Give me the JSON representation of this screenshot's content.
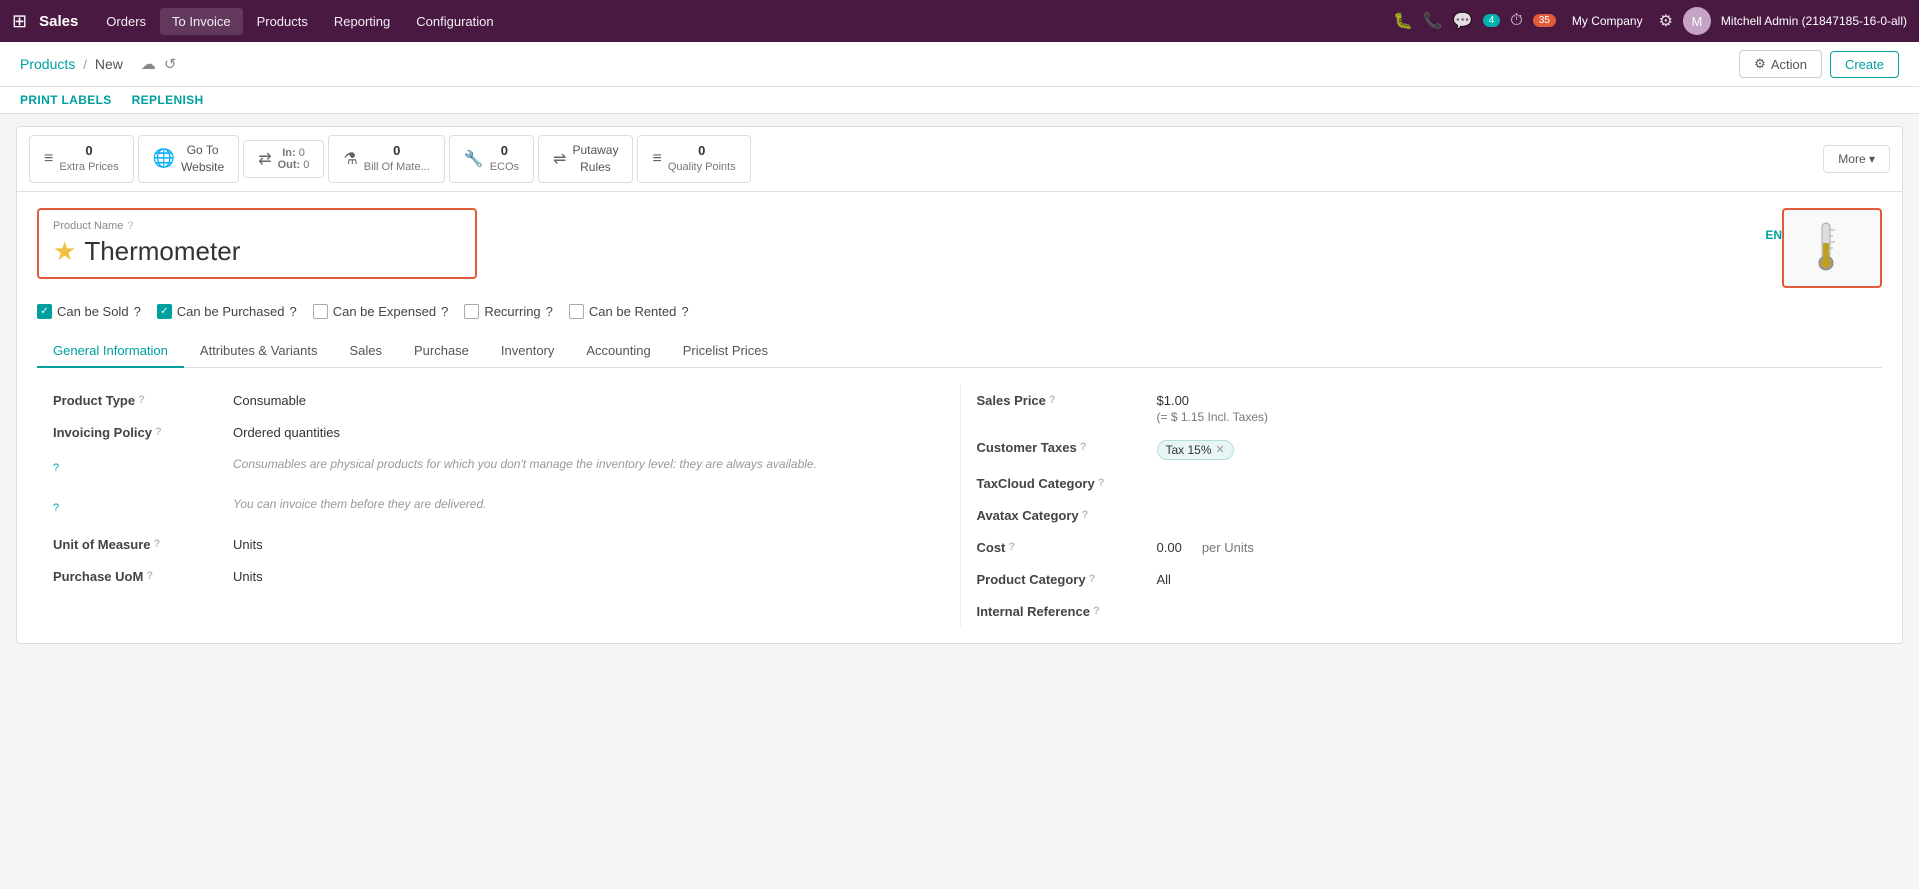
{
  "topbar": {
    "apps_icon": "⊞",
    "brand": "Sales",
    "nav_items": [
      "Orders",
      "To Invoice",
      "Products",
      "Reporting",
      "Configuration"
    ],
    "active_nav": "To Invoice",
    "bug_icon": "🐛",
    "phone_icon": "📞",
    "chat_icon": "💬",
    "chat_count": "4",
    "clock_icon": "⏱",
    "clock_count": "35",
    "company": "My Company",
    "settings_icon": "⚙",
    "user_initial": "M",
    "user_name": "Mitchell Admin (21847185-16-0-all)"
  },
  "breadcrumb": {
    "parent": "Products",
    "separator": "/",
    "current": "New",
    "cloud_icon": "☁",
    "refresh_icon": "↺"
  },
  "toolbar": {
    "action_label": "Action",
    "create_label": "Create",
    "gear_icon": "⚙"
  },
  "action_links": [
    {
      "label": "PRINT LABELS"
    },
    {
      "label": "REPLENISH"
    }
  ],
  "smart_buttons": [
    {
      "id": "extra-prices",
      "icon": "≡",
      "count": "0",
      "label": "Extra Prices"
    },
    {
      "id": "go-to-website",
      "icon": "🌐",
      "label": "Go To\nWebsite"
    },
    {
      "id": "in-out",
      "icon": "⇄",
      "in_count": "0",
      "out_count": "0",
      "in_label": "In:",
      "out_label": "Out:"
    },
    {
      "id": "bill-of-materials",
      "icon": "⚗",
      "count": "0",
      "label": "Bill Of Mate..."
    },
    {
      "id": "ecos",
      "icon": "🔧",
      "count": "0",
      "label": "ECOs"
    },
    {
      "id": "putaway-rules",
      "icon": "⇌",
      "label": "Putaway\nRules"
    },
    {
      "id": "quality-points",
      "icon": "≡",
      "count": "0",
      "label": "Quality Points"
    },
    {
      "id": "more",
      "label": "More ▾"
    }
  ],
  "product": {
    "name_label": "Product Name",
    "name_value": "Thermometer",
    "star": "★",
    "lang": "EN",
    "can_be_sold": true,
    "can_be_sold_label": "Can be Sold",
    "can_be_purchased": true,
    "can_be_purchased_label": "Can be Purchased",
    "can_be_expensed": false,
    "can_be_expensed_label": "Can be Expensed",
    "recurring": false,
    "recurring_label": "Recurring",
    "can_be_rented": false,
    "can_be_rented_label": "Can be Rented"
  },
  "tabs": [
    {
      "id": "general",
      "label": "General Information",
      "active": true
    },
    {
      "id": "attributes",
      "label": "Attributes & Variants"
    },
    {
      "id": "sales",
      "label": "Sales"
    },
    {
      "id": "purchase",
      "label": "Purchase"
    },
    {
      "id": "inventory",
      "label": "Inventory"
    },
    {
      "id": "accounting",
      "label": "Accounting"
    },
    {
      "id": "pricelist",
      "label": "Pricelist Prices"
    }
  ],
  "general_info": {
    "left": {
      "product_type_label": "Product Type",
      "product_type_value": "Consumable",
      "invoicing_policy_label": "Invoicing Policy",
      "invoicing_policy_value": "Ordered quantities",
      "help1_label": "?",
      "help1_value": "Consumables are physical products for which you don't manage the inventory level: they are always available.",
      "help2_label": "?",
      "help2_value": "You can invoice them before they are delivered.",
      "uom_label": "Unit of Measure",
      "uom_value": "Units",
      "purchase_uom_label": "Purchase UoM",
      "purchase_uom_value": "Units"
    },
    "right": {
      "sales_price_label": "Sales Price",
      "sales_price_value": "$1.00",
      "sales_price_incl": "(= $ 1.15 Incl. Taxes)",
      "customer_taxes_label": "Customer Taxes",
      "customer_taxes_value": "Tax 15%",
      "taxcloud_category_label": "TaxCloud Category",
      "taxcloud_category_value": "",
      "avatax_category_label": "Avatax Category",
      "avatax_category_value": "",
      "cost_label": "Cost",
      "cost_value": "0.00",
      "cost_unit": "per Units",
      "product_category_label": "Product Category",
      "product_category_value": "All",
      "internal_reference_label": "Internal Reference",
      "internal_reference_value": ""
    }
  }
}
